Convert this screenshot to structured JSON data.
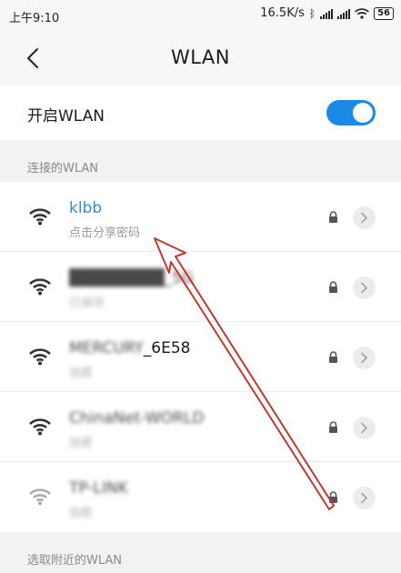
{
  "status": {
    "time": "上午9:10",
    "speed": "16.5K/s",
    "battery": "56"
  },
  "header": {
    "title": "WLAN"
  },
  "wlan_toggle": {
    "label": "开启WLAN",
    "enabled": true
  },
  "sections": {
    "connected": "连接的WLAN",
    "choose": "选取附近的WLAN"
  },
  "networks": [
    {
      "name": "klbb",
      "sub": "点击分享密码",
      "connected": true,
      "blurred": false,
      "weak": false
    },
    {
      "name": "████████_5G",
      "sub": "已保存",
      "connected": false,
      "blurred": true,
      "weak": false
    },
    {
      "name": "MERCURY",
      "name_suffix": "_6E58",
      "sub": "加密",
      "connected": false,
      "blurred": true,
      "weak": false
    },
    {
      "name": "ChinaNet-WORLD",
      "sub": "加密",
      "connected": false,
      "blurred": true,
      "weak": false
    },
    {
      "name": "TP-LINK",
      "sub": "加密",
      "connected": false,
      "blurred": true,
      "weak": true
    }
  ],
  "colors": {
    "accent": "#1b8ae6",
    "connected_text": "#2e8fd6",
    "annotation_arrow": "#c0392b"
  }
}
